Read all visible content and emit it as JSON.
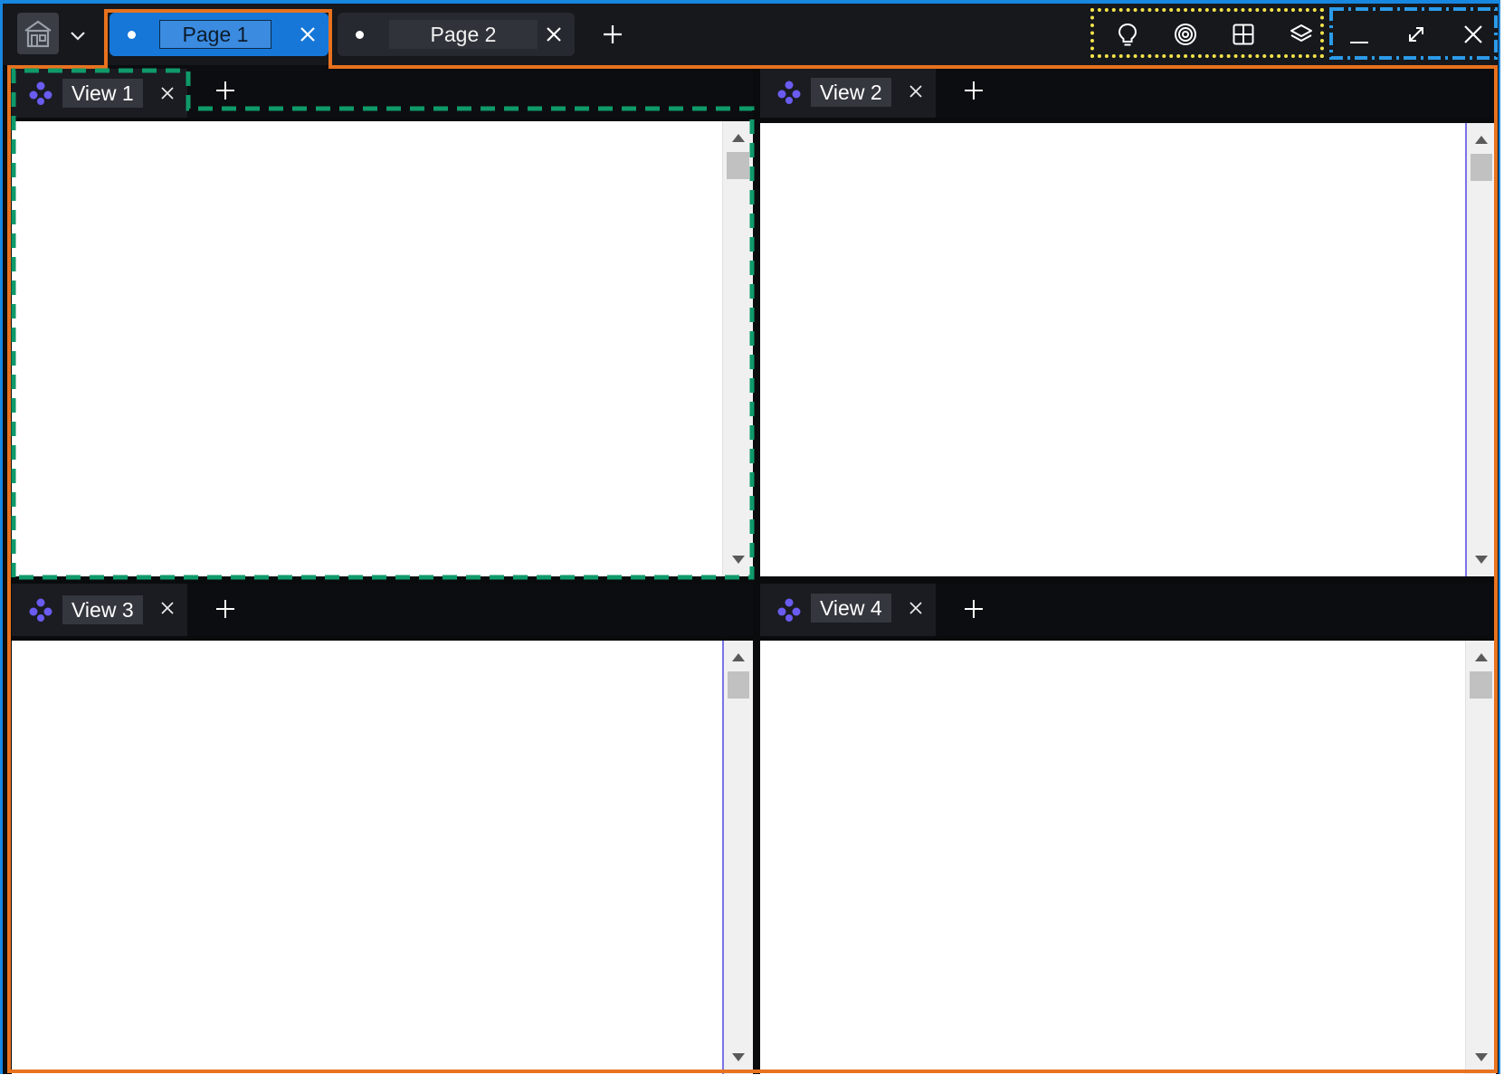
{
  "pages": {
    "tabs": [
      {
        "label": "Page 1",
        "active": true
      },
      {
        "label": "Page 2",
        "active": false
      }
    ],
    "add_icon": "plus-icon",
    "close_icon": "close-icon"
  },
  "home": {
    "icon": "home-icon",
    "caret_icon": "chevron-down-icon"
  },
  "toolbar": {
    "icons": [
      "lightbulb-icon",
      "target-icon",
      "grid-icon",
      "layers-icon"
    ]
  },
  "window_controls": {
    "icons": [
      "minimize-icon",
      "maximize-icon",
      "close-icon"
    ]
  },
  "views": [
    {
      "label": "View 1",
      "icon": "flow-node-icon"
    },
    {
      "label": "View 2",
      "icon": "flow-node-icon"
    },
    {
      "label": "View 3",
      "icon": "flow-node-icon"
    },
    {
      "label": "View 4",
      "icon": "flow-node-icon"
    }
  ],
  "colors": {
    "accent": "#1677d9",
    "frame_orange": "#e8721f",
    "frame_green": "#0f9a6a",
    "frame_yellow": "#f2e34a",
    "frame_blue": "#2c9be8",
    "view_icon": "#6a5cf0"
  }
}
